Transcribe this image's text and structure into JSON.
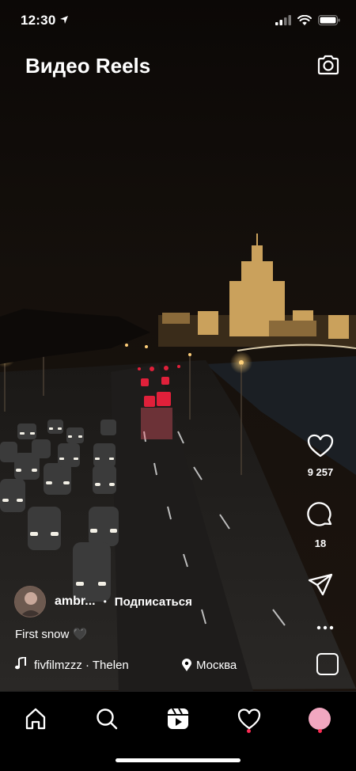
{
  "status_bar": {
    "time": "12:30"
  },
  "header": {
    "title": "Видео Reels"
  },
  "actions": {
    "likes": "9 257",
    "comments": "18"
  },
  "post": {
    "username": "ambr...",
    "separator": "•",
    "subscribe_label": "Подписаться",
    "caption": "First snow",
    "caption_emoji": "🖤",
    "audio_text": "fivfilmzzz · Thelen",
    "location": "Москва"
  },
  "nav": {
    "items": [
      "home-icon",
      "search-icon",
      "reels-icon",
      "heart-icon",
      "profile-avatar"
    ]
  },
  "colors": {
    "notification_dot": "#ff2d55",
    "background": "#000000"
  }
}
